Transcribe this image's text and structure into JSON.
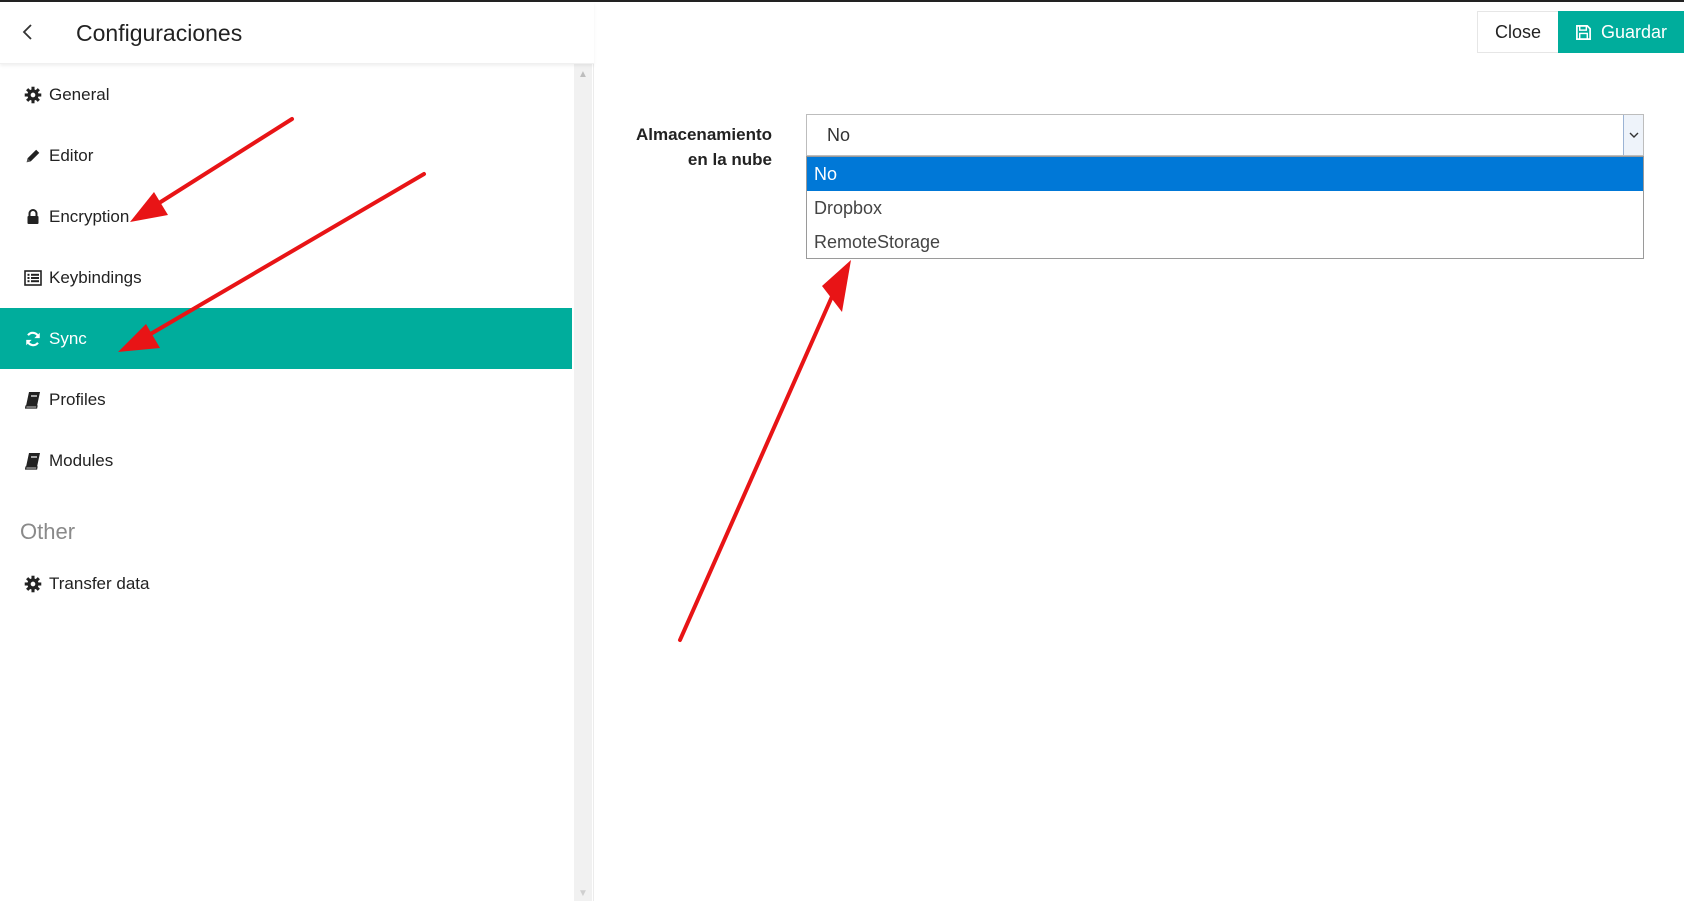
{
  "sidebar": {
    "title": "Configuraciones",
    "back_icon": "chevron-left-icon",
    "items": [
      {
        "label": "General",
        "icon": "gear-icon",
        "active": false
      },
      {
        "label": "Editor",
        "icon": "pencil-icon",
        "active": false
      },
      {
        "label": "Encryption",
        "icon": "lock-icon",
        "active": false
      },
      {
        "label": "Keybindings",
        "icon": "list-icon",
        "active": false
      },
      {
        "label": "Sync",
        "icon": "sync-icon",
        "active": true
      },
      {
        "label": "Profiles",
        "icon": "book-icon",
        "active": false
      },
      {
        "label": "Modules",
        "icon": "book-icon",
        "active": false
      }
    ],
    "section_other": "Other",
    "other_items": [
      {
        "label": "Transfer data",
        "icon": "gear-icon",
        "active": false
      }
    ]
  },
  "toolbar": {
    "close_label": "Close",
    "save_label": "Guardar",
    "save_icon": "floppy-disk-icon"
  },
  "form": {
    "cloud_storage_label": "Almacenamiento en la nube",
    "cloud_storage_value": "No",
    "options": [
      "No",
      "Dropbox",
      "RemoteStorage"
    ],
    "selected_option": "No"
  },
  "colors": {
    "accent": "#00ad9c",
    "dropdown_highlight": "#0078d7",
    "annotation_arrow": "#e81416"
  }
}
